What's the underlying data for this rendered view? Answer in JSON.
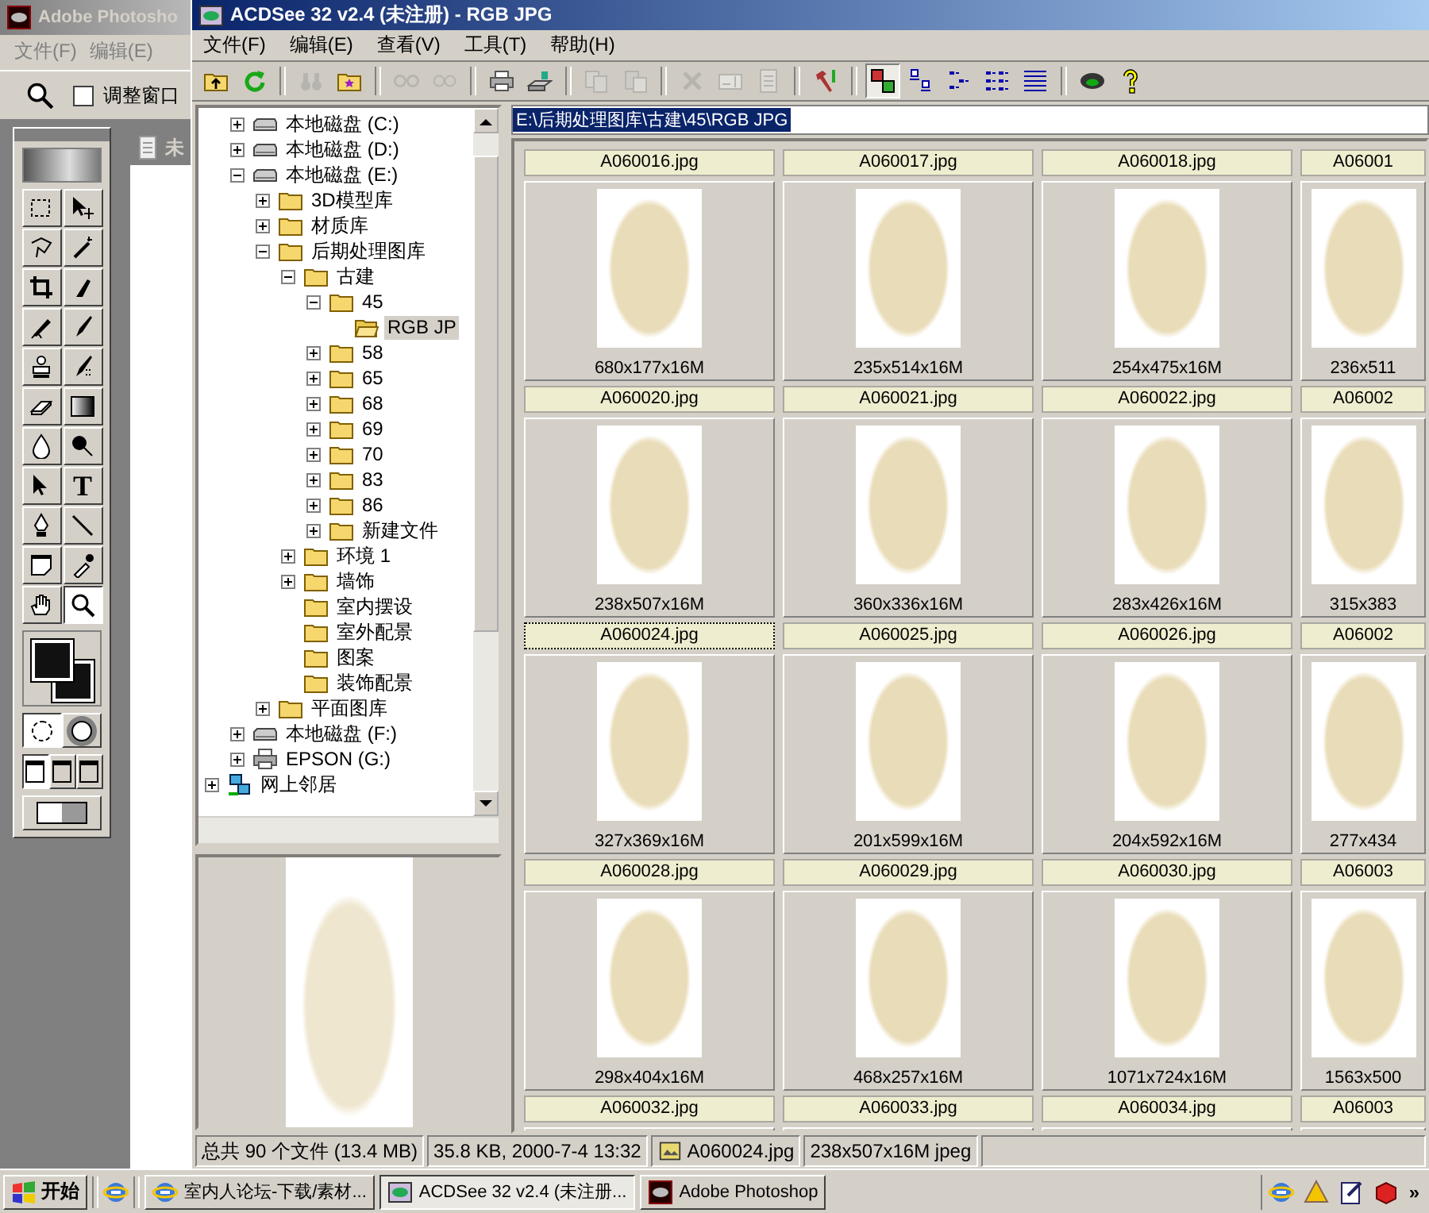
{
  "photoshop": {
    "title": "Adobe Photosho",
    "menu": [
      "文件(F)",
      "编辑(E)"
    ],
    "fit_window": {
      "label": "调整窗口",
      "checked": false
    },
    "tools": [
      {
        "kind": "marquee",
        "selected": false
      },
      {
        "kind": "move",
        "selected": false
      },
      {
        "kind": "lasso",
        "selected": false
      },
      {
        "kind": "magic-wand",
        "selected": false
      },
      {
        "kind": "crop",
        "selected": false
      },
      {
        "kind": "knife",
        "selected": false
      },
      {
        "kind": "airbrush",
        "selected": false
      },
      {
        "kind": "brush",
        "selected": false
      },
      {
        "kind": "stamp",
        "selected": false
      },
      {
        "kind": "history-brush",
        "selected": false
      },
      {
        "kind": "eraser",
        "selected": false
      },
      {
        "kind": "gradient",
        "selected": false
      },
      {
        "kind": "drop",
        "selected": false
      },
      {
        "kind": "burn",
        "selected": false
      },
      {
        "kind": "arrow",
        "selected": false
      },
      {
        "kind": "type",
        "glyph": "T",
        "selected": false
      },
      {
        "kind": "pen",
        "selected": false
      },
      {
        "kind": "line",
        "selected": false
      },
      {
        "kind": "note",
        "selected": false
      },
      {
        "kind": "eyedropper",
        "selected": false
      },
      {
        "kind": "hand",
        "selected": false
      },
      {
        "kind": "zoom",
        "selected": true
      }
    ],
    "mask_modes": [
      {
        "selected": true
      },
      {
        "selected": false
      }
    ],
    "screen_modes": [
      {
        "selected": true
      },
      {
        "selected": false
      },
      {
        "selected": false
      }
    ],
    "document": {
      "title": "未"
    }
  },
  "acdsee": {
    "title": "ACDSee 32 v2.4 (未注册) - RGB JPG",
    "menu": [
      "文件(F)",
      "编辑(E)",
      "查看(V)",
      "工具(T)",
      "帮助(H)"
    ],
    "toolbar": [
      [
        {
          "kind": "folder-up",
          "disabled": false,
          "selected": false
        },
        {
          "kind": "refresh",
          "disabled": false,
          "selected": false
        }
      ],
      [
        {
          "kind": "binoculars",
          "disabled": true,
          "selected": false
        },
        {
          "kind": "folder-star",
          "disabled": false,
          "selected": false
        }
      ],
      [
        {
          "kind": "small-circles",
          "disabled": true,
          "selected": false
        },
        {
          "kind": "large-circles",
          "disabled": true,
          "selected": false
        }
      ],
      [
        {
          "kind": "printer",
          "disabled": false,
          "selected": false
        },
        {
          "kind": "scanner",
          "disabled": false,
          "selected": false
        }
      ],
      [
        {
          "kind": "copy",
          "disabled": true,
          "selected": false
        },
        {
          "kind": "paste",
          "disabled": true,
          "selected": false
        }
      ],
      [
        {
          "kind": "delete",
          "disabled": true,
          "selected": false
        },
        {
          "kind": "rename",
          "disabled": true,
          "selected": false
        },
        {
          "kind": "document",
          "disabled": true,
          "selected": false
        }
      ],
      [
        {
          "kind": "hammer",
          "disabled": false,
          "selected": false
        }
      ],
      [
        {
          "kind": "monitors",
          "disabled": false,
          "selected": true
        },
        {
          "kind": "large-icons",
          "disabled": false,
          "selected": false
        },
        {
          "kind": "small-icons",
          "disabled": false,
          "selected": false
        },
        {
          "kind": "list",
          "disabled": false,
          "selected": false
        },
        {
          "kind": "details",
          "disabled": false,
          "selected": false
        }
      ],
      [
        {
          "kind": "eye",
          "disabled": false,
          "selected": false
        },
        {
          "kind": "help",
          "disabled": false,
          "selected": false
        }
      ]
    ],
    "tree": [
      {
        "children": [
          {
            "label": "本地磁盘 (C:)",
            "kind": "drive",
            "expanded": false,
            "selected": false
          },
          {
            "label": "本地磁盘 (D:)",
            "kind": "drive",
            "expanded": false,
            "selected": false
          },
          {
            "label": "本地磁盘 (E:)",
            "kind": "drive",
            "expanded": true,
            "selected": false,
            "children": [
              {
                "label": "3D模型库",
                "kind": "folder",
                "expanded": false,
                "selected": false
              },
              {
                "label": "材质库",
                "kind": "folder",
                "expanded": false,
                "selected": false
              },
              {
                "label": "后期处理图库",
                "kind": "folder",
                "expanded": true,
                "selected": false,
                "children": [
                  {
                    "label": "古建",
                    "kind": "folder",
                    "expanded": true,
                    "selected": false,
                    "children": [
                      {
                        "label": "45",
                        "kind": "folder",
                        "expanded": true,
                        "selected": false,
                        "children": [
                          {
                            "label": "RGB JP",
                            "kind": "open-folder",
                            "selected": true
                          }
                        ]
                      },
                      {
                        "label": "58",
                        "kind": "folder",
                        "expanded": false,
                        "selected": false
                      },
                      {
                        "label": "65",
                        "kind": "folder",
                        "expanded": false,
                        "selected": false
                      },
                      {
                        "label": "68",
                        "kind": "folder",
                        "expanded": false,
                        "selected": false
                      },
                      {
                        "label": "69",
                        "kind": "folder",
                        "expanded": false,
                        "selected": false
                      },
                      {
                        "label": "70",
                        "kind": "folder",
                        "expanded": false,
                        "selected": false
                      },
                      {
                        "label": "83",
                        "kind": "folder",
                        "expanded": false,
                        "selected": false
                      },
                      {
                        "label": "86",
                        "kind": "folder",
                        "expanded": false,
                        "selected": false
                      },
                      {
                        "label": "新建文件",
                        "kind": "folder",
                        "expanded": false,
                        "selected": false
                      }
                    ]
                  },
                  {
                    "label": "环境 1",
                    "kind": "folder",
                    "expanded": false,
                    "selected": false
                  },
                  {
                    "label": "墙饰",
                    "kind": "folder",
                    "expanded": false,
                    "selected": false
                  },
                  {
                    "label": "室内摆设",
                    "kind": "folder",
                    "selected": false
                  },
                  {
                    "label": "室外配景",
                    "kind": "folder",
                    "selected": false
                  },
                  {
                    "label": "图案",
                    "kind": "folder",
                    "selected": false
                  },
                  {
                    "label": "装饰配景",
                    "kind": "folder",
                    "selected": false
                  }
                ]
              },
              {
                "label": "平面图库",
                "kind": "folder",
                "expanded": false,
                "selected": false
              }
            ]
          },
          {
            "label": "本地磁盘 (F:)",
            "kind": "drive",
            "expanded": false,
            "selected": false
          },
          {
            "label": "EPSON (G:)",
            "kind": "printer",
            "expanded": false,
            "selected": false
          }
        ]
      },
      {
        "label": "网上邻居",
        "kind": "network",
        "expanded": false,
        "selected": false
      }
    ],
    "path": "E:\\后期处理图库\\古建\\45\\RGB JPG",
    "thumbnails": [
      {
        "name": "A060016.jpg",
        "size": "680x177x16M",
        "selected": false
      },
      {
        "name": "A060017.jpg",
        "size": "235x514x16M",
        "selected": false
      },
      {
        "name": "A060018.jpg",
        "size": "254x475x16M",
        "selected": false
      },
      {
        "name": "A06001",
        "size": "236x511",
        "selected": false
      },
      {
        "name": "A060020.jpg",
        "size": "238x507x16M",
        "selected": false
      },
      {
        "name": "A060021.jpg",
        "size": "360x336x16M",
        "selected": false
      },
      {
        "name": "A060022.jpg",
        "size": "283x426x16M",
        "selected": false
      },
      {
        "name": "A06002",
        "size": "315x383",
        "selected": false
      },
      {
        "name": "A060024.jpg",
        "size": "327x369x16M",
        "selected": true
      },
      {
        "name": "A060025.jpg",
        "size": "201x599x16M",
        "selected": false
      },
      {
        "name": "A060026.jpg",
        "size": "204x592x16M",
        "selected": false
      },
      {
        "name": "A06002",
        "size": "277x434",
        "selected": false
      },
      {
        "name": "A060028.jpg",
        "size": "298x404x16M",
        "selected": false
      },
      {
        "name": "A060029.jpg",
        "size": "468x257x16M",
        "selected": false
      },
      {
        "name": "A060030.jpg",
        "size": "1071x724x16M",
        "selected": false
      },
      {
        "name": "A06003",
        "size": "1563x500",
        "selected": false
      },
      {
        "name": "A060032.jpg",
        "selected": false
      },
      {
        "name": "A060033.jpg",
        "selected": false
      },
      {
        "name": "A060034.jpg",
        "selected": false
      },
      {
        "name": "A06003",
        "selected": false
      }
    ],
    "status": [
      {
        "text": "总共 90 个文件 (13.4 MB)"
      },
      {
        "text": "35.8 KB, 2000-7-4 13:32"
      },
      {
        "text": "A060024.jpg",
        "kind": "file"
      },
      {
        "text": "238x507x16M jpeg"
      }
    ]
  },
  "taskbar": {
    "start": "开始",
    "tasks": [
      {
        "label": "室内人论坛-下载/素材...",
        "kind": "browser",
        "selected": false
      },
      {
        "label": "ACDSee 32 v2.4 (未注册...",
        "kind": "viewer",
        "selected": true
      },
      {
        "label": "Adobe Photoshop",
        "kind": "photoshop",
        "selected": false
      }
    ],
    "more": "»"
  }
}
